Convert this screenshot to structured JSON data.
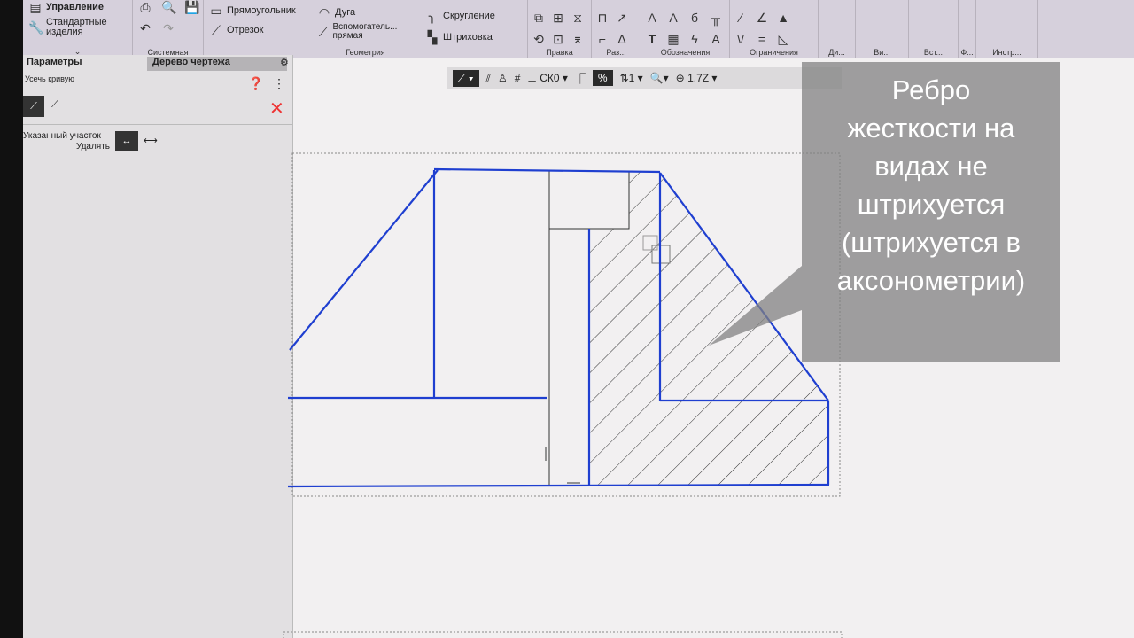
{
  "ribbon": {
    "manage": "Управление",
    "std_parts": "Стандартные изделия",
    "system_group": "Системная",
    "rectangle": "Прямоугольник",
    "arc": "Дуга",
    "fillet": "Скругление",
    "segment": "Отрезок",
    "aux_line": "Вспомогатель... прямая",
    "hatch": "Штриховка",
    "geometry_group": "Геометрия",
    "edit_group": "Правка",
    "dim_group": "Раз...",
    "notation_group": "Обозначения",
    "constraints_group": "Ограничения",
    "diag_group": "Ди...",
    "view_group": "Ви...",
    "ins_group": "Вст...",
    "f_group": "Ф...",
    "tools_group": "Инстр..."
  },
  "left_panel": {
    "tab_params": "Параметры",
    "tab_tree": "Дерево чертежа",
    "command": "Усечь кривую",
    "specified_area": "Указанный участок",
    "delete": "Удалять"
  },
  "toolbar": {
    "cs": "СК0",
    "layer": "1",
    "zoom": "1.7Z"
  },
  "overlay": {
    "lines": [
      "Ребро",
      "жесткости на",
      "видах не",
      "штрихуется",
      "(штрихуется в",
      "аксонометрии)"
    ]
  },
  "colors": {
    "drawing": "#1f3fd0",
    "hatch": "#333333"
  }
}
